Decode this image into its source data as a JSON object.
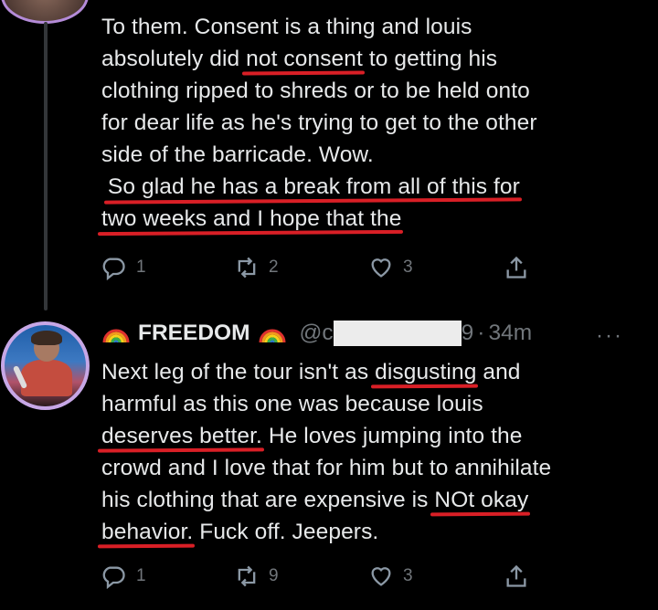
{
  "tweet1": {
    "lines": [
      {
        "pre": "To them. Consent is a thing and louis",
        "u": "",
        "post": ""
      },
      {
        "pre": "absolutely did ",
        "u": "not consent",
        "post": " to getting his"
      },
      {
        "pre": "clothing ripped to shreds or to be held onto",
        "u": "",
        "post": ""
      },
      {
        "pre": "for dear life as he's trying to get to the other",
        "u": "",
        "post": ""
      },
      {
        "pre": "side of the barricade. Wow.",
        "u": "",
        "post": ""
      },
      {
        "pre": " ",
        "u": "So glad he has a break from all of this for",
        "post": ""
      },
      {
        "pre": "",
        "u": "two weeks and I hope that the",
        "post": ""
      }
    ],
    "replies": "1",
    "retweets": "2",
    "likes": "3"
  },
  "tweet2": {
    "name": "FREEDOM",
    "handle": "@c",
    "handle_end": "9",
    "time": "34m",
    "separator": "·",
    "more": "···",
    "lines": [
      {
        "pre": "Next leg of the tour isn't as ",
        "u": "disgusting",
        "post": " and"
      },
      {
        "pre": "harmful as this one was because louis",
        "u": "",
        "post": ""
      },
      {
        "pre": "",
        "u": "deserves better.",
        "post": " He loves jumping into the"
      },
      {
        "pre": "crowd and I love that for him but to annihilate",
        "u": "",
        "post": ""
      },
      {
        "pre": "his clothing that are expensive is ",
        "u": "NOt okay",
        "post": ""
      },
      {
        "pre": "",
        "u": "behavior.",
        "post": " Fuck off. Jeepers."
      }
    ],
    "replies": "1",
    "retweets": "9",
    "likes": "3"
  },
  "icons": {
    "reply": "reply-icon",
    "retweet": "retweet-icon",
    "like": "heart-icon",
    "share": "share-icon"
  }
}
